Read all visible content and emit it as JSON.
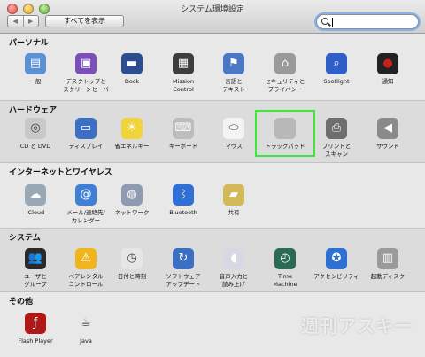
{
  "window": {
    "title": "システム環境設定"
  },
  "toolbar": {
    "back": "◀",
    "forward": "▶",
    "show_all": "すべてを表示",
    "search_value": ""
  },
  "sections": [
    {
      "label": "パーソナル",
      "items": [
        {
          "name": "general",
          "label": "一般",
          "icon": "general-icon",
          "color": "#5b8fd6"
        },
        {
          "name": "desktop-screensaver",
          "label": "デスクトップと\nスクリーンセーバ",
          "icon": "desktop-icon",
          "color": "#7c4fb8"
        },
        {
          "name": "dock",
          "label": "Dock",
          "icon": "dock-icon",
          "color": "#2c4d8f"
        },
        {
          "name": "mission-control",
          "label": "Mission\nControl",
          "icon": "mission-control-icon",
          "color": "#3d3d3d"
        },
        {
          "name": "language-text",
          "label": "言語と\nテキスト",
          "icon": "flag-icon",
          "color": "#4a78c4"
        },
        {
          "name": "security-privacy",
          "label": "セキュリティと\nプライバシー",
          "icon": "house-lock-icon",
          "color": "#9a9a9a"
        },
        {
          "name": "spotlight",
          "label": "Spotlight",
          "icon": "spotlight-icon",
          "color": "#2f5ec7"
        },
        {
          "name": "notifications",
          "label": "通知",
          "icon": "notifications-icon",
          "color": "#cc2020"
        }
      ]
    },
    {
      "label": "ハードウェア",
      "items": [
        {
          "name": "cd-dvd",
          "label": "CD と DVD",
          "icon": "disc-icon",
          "color": "#c8c8c8"
        },
        {
          "name": "displays",
          "label": "ディスプレイ",
          "icon": "display-icon",
          "color": "#3a6fc4"
        },
        {
          "name": "energy-saver",
          "label": "省エネルギー",
          "icon": "bulb-icon",
          "color": "#f1d33a"
        },
        {
          "name": "keyboard",
          "label": "キーボード",
          "icon": "keyboard-icon",
          "color": "#bdbdbd"
        },
        {
          "name": "mouse",
          "label": "マウス",
          "icon": "mouse-icon",
          "color": "#f4f4f4"
        },
        {
          "name": "trackpad",
          "label": "トラックパッド",
          "icon": "trackpad-icon",
          "color": "#b8b8b8"
        },
        {
          "name": "print-scan",
          "label": "プリントと\nスキャン",
          "icon": "printer-icon",
          "color": "#6e6e6e"
        },
        {
          "name": "sound",
          "label": "サウンド",
          "icon": "speaker-icon",
          "color": "#8a8a8a"
        }
      ]
    },
    {
      "label": "インターネットとワイヤレス",
      "items": [
        {
          "name": "icloud",
          "label": "iCloud",
          "icon": "cloud-icon",
          "color": "#9aa7b5"
        },
        {
          "name": "mail-contacts-calendars",
          "label": "メール/連絡先/\nカレンダー",
          "icon": "at-icon",
          "color": "#3f7fd6"
        },
        {
          "name": "network",
          "label": "ネットワーク",
          "icon": "globe-icon",
          "color": "#8e9bb0"
        },
        {
          "name": "bluetooth",
          "label": "Bluetooth",
          "icon": "bluetooth-icon",
          "color": "#2f6fd6"
        },
        {
          "name": "sharing",
          "label": "共有",
          "icon": "folder-icon",
          "color": "#d3b85a"
        }
      ]
    },
    {
      "label": "システム",
      "items": [
        {
          "name": "users-groups",
          "label": "ユーザと\nグループ",
          "icon": "users-icon",
          "color": "#2a2a2a"
        },
        {
          "name": "parental-controls",
          "label": "ペアレンタル\nコントロール",
          "icon": "parental-icon",
          "color": "#f0b51e"
        },
        {
          "name": "date-time",
          "label": "日付と時刻",
          "icon": "clock-icon",
          "color": "#e6e6e6"
        },
        {
          "name": "software-update",
          "label": "ソフトウェア\nアップデート",
          "icon": "update-icon",
          "color": "#3a6fc4"
        },
        {
          "name": "dictation-speech",
          "label": "音声入力と\n読み上げ",
          "icon": "microphone-icon",
          "color": "#d8d8e4"
        },
        {
          "name": "time-machine",
          "label": "Time\nMachine",
          "icon": "time-machine-icon",
          "color": "#2b6b55"
        },
        {
          "name": "accessibility",
          "label": "アクセシビリティ",
          "icon": "accessibility-icon",
          "color": "#2d6fd3"
        },
        {
          "name": "startup-disk",
          "label": "起動ディスク",
          "icon": "disk-icon",
          "color": "#9a9a9a"
        }
      ]
    },
    {
      "label": "その他",
      "items": [
        {
          "name": "flash-player",
          "label": "Flash Player",
          "icon": "flash-icon",
          "color": "#b01818"
        },
        {
          "name": "java",
          "label": "Java",
          "icon": "java-icon",
          "color": "#e8e8e8"
        }
      ]
    }
  ],
  "watermark": "週刊アスキー"
}
